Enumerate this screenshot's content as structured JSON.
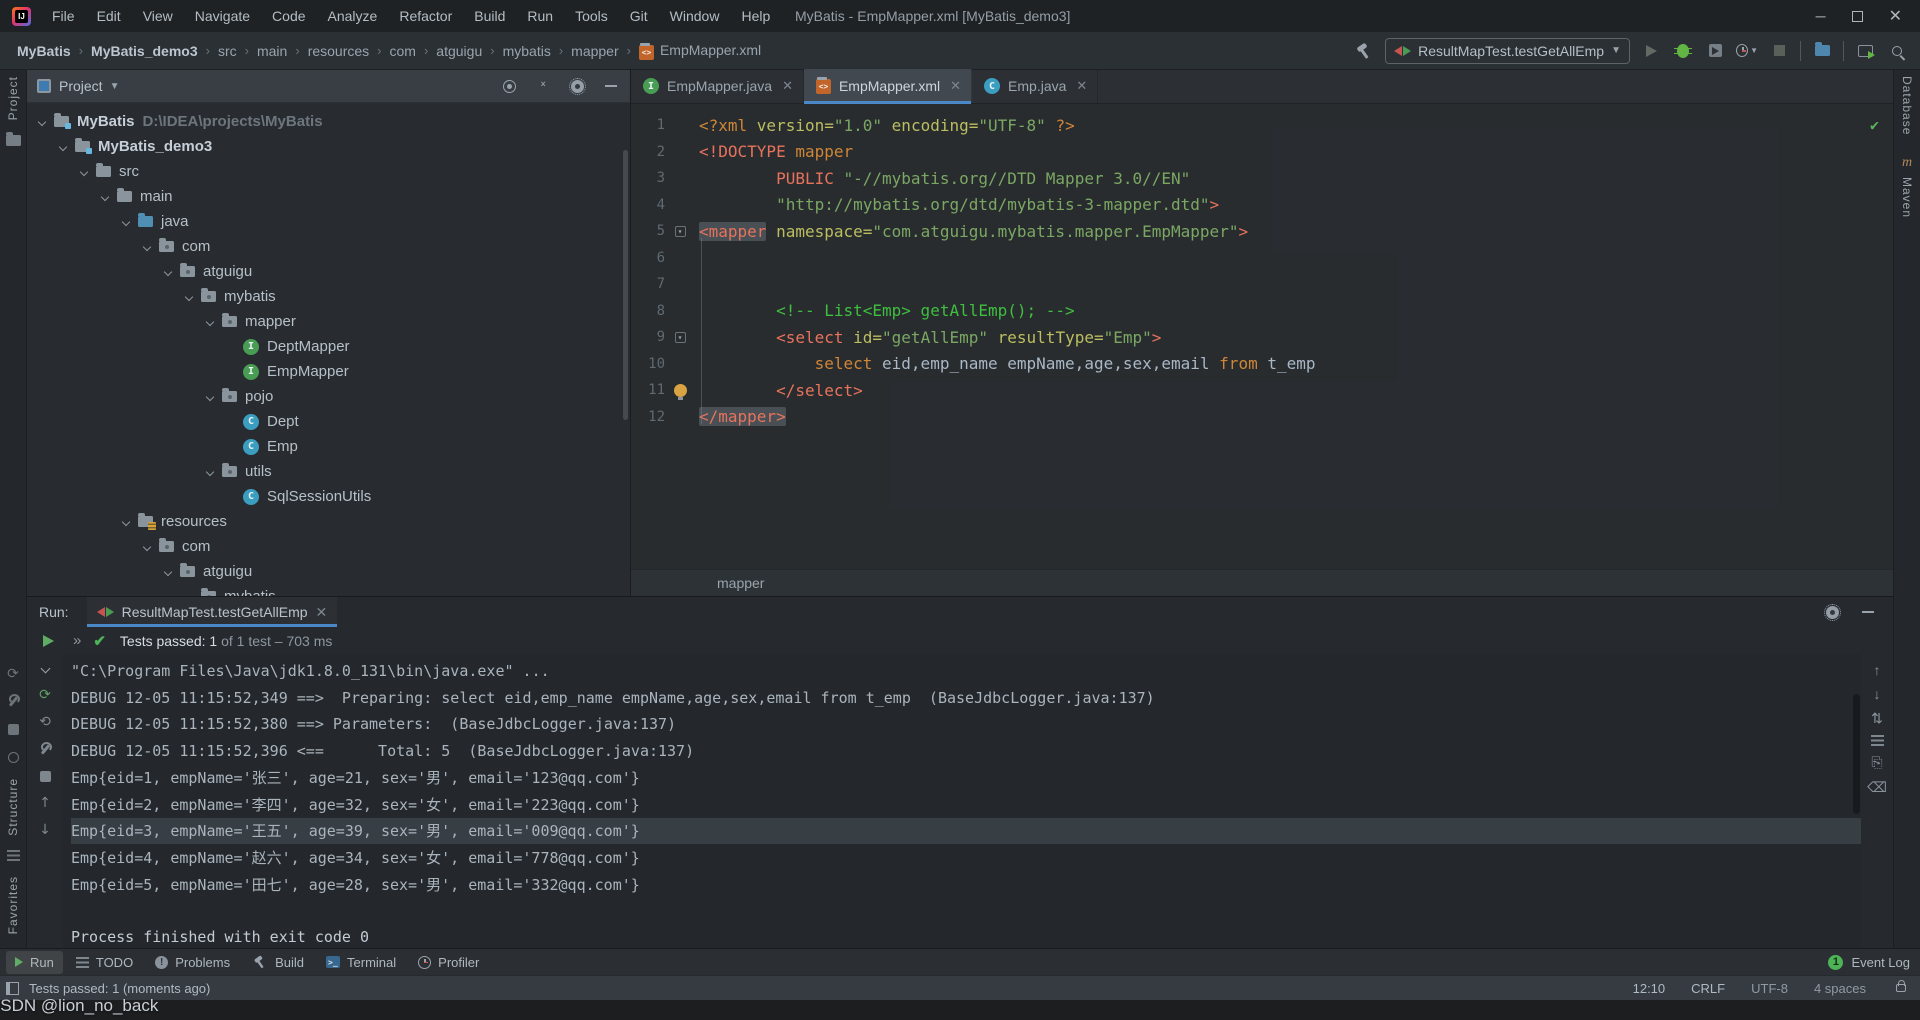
{
  "window": {
    "title": "MyBatis - EmpMapper.xml [MyBatis_demo3]"
  },
  "menu": [
    "File",
    "Edit",
    "View",
    "Navigate",
    "Code",
    "Analyze",
    "Refactor",
    "Build",
    "Run",
    "Tools",
    "Git",
    "Window",
    "Help"
  ],
  "breadcrumbs": [
    "MyBatis",
    "MyBatis_demo3",
    "src",
    "main",
    "resources",
    "com",
    "atguigu",
    "mybatis",
    "mapper",
    "EmpMapper.xml"
  ],
  "toolbar": {
    "run_config": "ResultMapTest.testGetAllEmp"
  },
  "left_strip": {
    "project": "Project",
    "structure": "Structure",
    "favorites": "Favorites"
  },
  "right_strip": {
    "database": "Database",
    "maven": "Maven",
    "maven_letter": "m"
  },
  "project_panel": {
    "title": "Project",
    "tree": [
      {
        "d": 0,
        "icon": "folder-project",
        "label": "MyBatis",
        "extra": "D:\\IDEA\\projects\\MyBatis",
        "bold": true,
        "chev": true
      },
      {
        "d": 1,
        "icon": "folder-project",
        "label": "MyBatis_demo3",
        "bold": true,
        "chev": true
      },
      {
        "d": 2,
        "icon": "folder",
        "label": "src",
        "chev": true
      },
      {
        "d": 3,
        "icon": "folder",
        "label": "main",
        "chev": true
      },
      {
        "d": 4,
        "icon": "folder-src",
        "label": "java",
        "chev": true
      },
      {
        "d": 5,
        "icon": "package",
        "label": "com",
        "chev": true
      },
      {
        "d": 6,
        "icon": "package",
        "label": "atguigu",
        "chev": true
      },
      {
        "d": 7,
        "icon": "package",
        "label": "mybatis",
        "chev": true
      },
      {
        "d": 8,
        "icon": "package",
        "label": "mapper",
        "chev": true
      },
      {
        "d": 9,
        "icon": "interface",
        "label": "DeptMapper"
      },
      {
        "d": 9,
        "icon": "interface",
        "label": "EmpMapper"
      },
      {
        "d": 8,
        "icon": "package",
        "label": "pojo",
        "chev": true
      },
      {
        "d": 9,
        "icon": "class",
        "label": "Dept"
      },
      {
        "d": 9,
        "icon": "class",
        "label": "Emp"
      },
      {
        "d": 8,
        "icon": "package",
        "label": "utils",
        "chev": true
      },
      {
        "d": 9,
        "icon": "class",
        "label": "SqlSessionUtils"
      },
      {
        "d": 4,
        "icon": "folder-res",
        "label": "resources",
        "chev": true
      },
      {
        "d": 5,
        "icon": "package",
        "label": "com",
        "chev": true
      },
      {
        "d": 6,
        "icon": "package",
        "label": "atguigu",
        "chev": true
      },
      {
        "d": 7,
        "icon": "package",
        "label": "mybatis",
        "chev": true
      }
    ]
  },
  "editor": {
    "tabs": [
      {
        "label": "EmpMapper.java",
        "icon": "interface",
        "active": false
      },
      {
        "label": "EmpMapper.xml",
        "icon": "xml",
        "active": true
      },
      {
        "label": "Emp.java",
        "icon": "class",
        "active": false
      }
    ],
    "breadcrumb": "mapper",
    "marks": {
      "5": "fold",
      "9": "fold",
      "11": "bulb"
    },
    "lines": [
      [
        [
          "kw",
          "<?xml "
        ],
        [
          "attr",
          "version="
        ],
        [
          "str",
          "\"1.0\""
        ],
        [
          "pl",
          " "
        ],
        [
          "attr",
          "encoding="
        ],
        [
          "str",
          "\"UTF-8\""
        ],
        [
          "kw",
          " ?>"
        ]
      ],
      [
        [
          "tag",
          "<!DOCTYPE "
        ],
        [
          "kw",
          "mapper"
        ]
      ],
      [
        [
          "pl",
          "        "
        ],
        [
          "tag",
          "PUBLIC "
        ],
        [
          "str",
          "\"-//mybatis.org//DTD Mapper 3.0//EN\""
        ]
      ],
      [
        [
          "pl",
          "        "
        ],
        [
          "str",
          "\"http://mybatis.org/dtd/mybatis-3-mapper.dtd\""
        ],
        [
          "tag",
          ">"
        ]
      ],
      [
        [
          "taghl",
          "<mapper"
        ],
        [
          "pl",
          " "
        ],
        [
          "attr",
          "namespace="
        ],
        [
          "str",
          "\"com.atguigu.mybatis.mapper.EmpMapper\""
        ],
        [
          "tag",
          ">"
        ]
      ],
      [],
      [],
      [
        [
          "pl",
          "        "
        ],
        [
          "cm",
          "<!-- List<Emp> getAllEmp(); -->"
        ]
      ],
      [
        [
          "pl",
          "        "
        ],
        [
          "tag",
          "<select "
        ],
        [
          "attr",
          "id="
        ],
        [
          "str",
          "\"getAllEmp\""
        ],
        [
          "pl",
          " "
        ],
        [
          "attr",
          "resultType="
        ],
        [
          "str",
          "\"Emp\""
        ],
        [
          "tag",
          ">"
        ]
      ],
      [
        [
          "pl",
          "            "
        ],
        [
          "kw",
          "select"
        ],
        [
          "pl",
          " eid,emp_name empName,age,sex,email "
        ],
        [
          "kw",
          "from"
        ],
        [
          "pl",
          " t_emp"
        ]
      ],
      [
        [
          "pl",
          "        "
        ],
        [
          "tag",
          "</select>"
        ]
      ],
      [
        [
          "taghl",
          "</mapper>"
        ]
      ]
    ]
  },
  "run_panel": {
    "label": "Run:",
    "tab": "ResultMapTest.testGetAllEmp",
    "status_strong": "Tests passed: 1",
    "status_dim1": "of 1 test",
    "status_dim2": "– 703 ms",
    "console": [
      {
        "text": "\"C:\\Program Files\\Java\\jdk1.8.0_131\\bin\\java.exe\" ..."
      },
      {
        "text": "DEBUG 12-05 11:15:52,349 ==>  Preparing: select eid,emp_name empName,age,sex,email from t_emp  (BaseJdbcLogger.java:137)"
      },
      {
        "text": "DEBUG 12-05 11:15:52,380 ==> Parameters:  (BaseJdbcLogger.java:137)"
      },
      {
        "text": "DEBUG 12-05 11:15:52,396 <==      Total: 5  (BaseJdbcLogger.java:137)"
      },
      {
        "text": "Emp{eid=1, empName='张三', age=21, sex='男', email='123@qq.com'}"
      },
      {
        "text": "Emp{eid=2, empName='李四', age=32, sex='女', email='223@qq.com'}"
      },
      {
        "text": "Emp{eid=3, empName='王五', age=39, sex='男', email='009@qq.com'}",
        "hl": true
      },
      {
        "text": "Emp{eid=4, empName='赵六', age=34, sex='女', email='778@qq.com'}"
      },
      {
        "text": "Emp{eid=5, empName='田七', age=28, sex='男', email='332@qq.com'}"
      },
      {
        "text": ""
      },
      {
        "text": "Process finished with exit code 0",
        "bright": true
      }
    ]
  },
  "tool_buttons": [
    {
      "label": "Run",
      "icon": "run-icon",
      "active": true
    },
    {
      "label": "TODO",
      "icon": "todo-icon"
    },
    {
      "label": "Problems",
      "icon": "problems-icon"
    },
    {
      "label": "Build",
      "icon": "build-icon"
    },
    {
      "label": "Terminal",
      "icon": "terminal-icon"
    },
    {
      "label": "Profiler",
      "icon": "profiler-icon"
    }
  ],
  "event_log": {
    "count": "1",
    "label": "Event Log"
  },
  "status_bar": {
    "left": "Tests passed: 1 (moments ago)",
    "time": "12:10",
    "line_ending": "CRLF",
    "encoding": "UTF-8",
    "indent": "4 spaces"
  },
  "watermark": "CSDN @lion_no_back",
  "colors": {
    "kw": "#cf8637",
    "tag": "#e8735c",
    "attr": "#bcbe5f",
    "str": "#7ba763",
    "cm": "#3fbf3f",
    "pl": "#a9b7c6",
    "accent": "#4a88c7",
    "test_green": "#4db356"
  }
}
